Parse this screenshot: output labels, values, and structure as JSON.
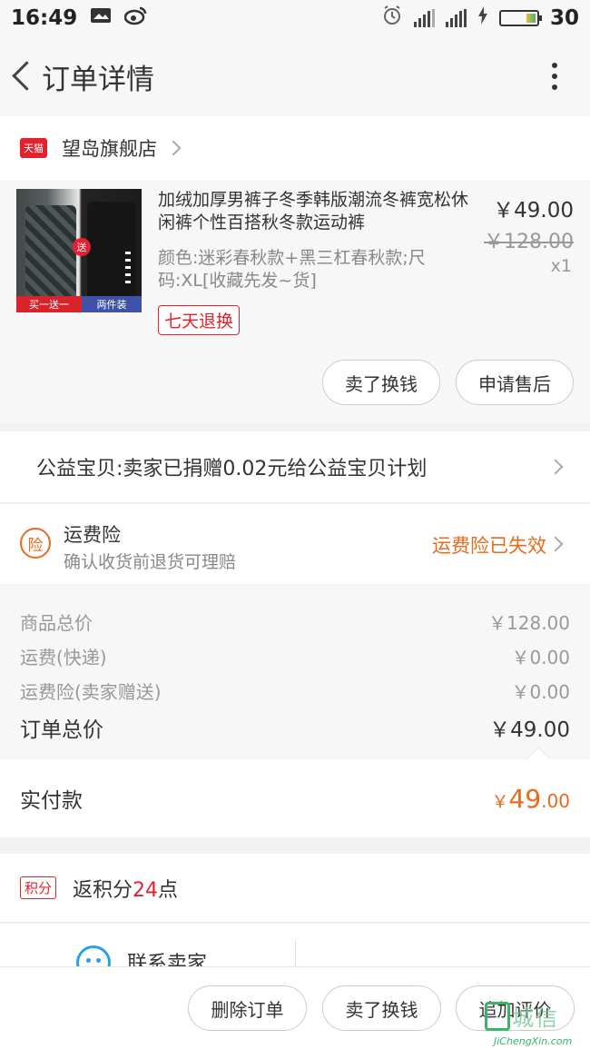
{
  "status_bar": {
    "time": "16:49",
    "battery": "30",
    "icons": [
      "message-icon",
      "weibo-icon",
      "alarm-icon",
      "signal-icon",
      "charging-icon"
    ]
  },
  "header": {
    "title": "订单详情"
  },
  "shop": {
    "badge": "天猫",
    "name": "望岛旗舰店"
  },
  "product": {
    "title": "加绒加厚男裤子冬季韩版潮流冬裤宽松休闲裤个性百搭秋冬款运动裤",
    "spec": "颜色:迷彩春秋款+黑三杠春秋款;尺码:XL[收藏先发~货]",
    "tag": "七天退换",
    "price": "￥49.00",
    "original_price": "￥128.00",
    "quantity": "x1",
    "image_badge_left": "买一送一",
    "image_badge_right": "两件装",
    "image_gift": "送",
    "buttons": {
      "sell": "卖了换钱",
      "after_sale": "申请售后"
    }
  },
  "charity": {
    "text": "公益宝贝:卖家已捐赠0.02元给公益宝贝计划"
  },
  "insurance": {
    "badge": "险",
    "title": "运费险",
    "subtitle": "确认收货前退货可理赔",
    "status": "运费险已失效"
  },
  "fees": {
    "goods_label": "商品总价",
    "goods_value": "￥128.00",
    "shipping_label": "运费(快递)",
    "shipping_value": "￥0.00",
    "insurance_label": "运费险(卖家赠送)",
    "insurance_value": "￥0.00",
    "total_label": "订单总价",
    "total_value": "￥49.00"
  },
  "payment": {
    "label": "实付款",
    "currency": "￥",
    "int": "49",
    "dec": ".00"
  },
  "points": {
    "tag": "积分",
    "prefix": "返积分",
    "value": "24",
    "suffix": "点"
  },
  "contact": {
    "label": "联系卖家"
  },
  "bottom_bar": {
    "delete": "删除订单",
    "sell": "卖了换钱",
    "review": "追加评价"
  },
  "watermark": {
    "cn": "城信",
    "en": "JiChengXin.com"
  },
  "colors": {
    "accent_orange": "#ea6a1d",
    "tmall_red": "#e4222f",
    "contact_blue": "#2a9ef0"
  }
}
